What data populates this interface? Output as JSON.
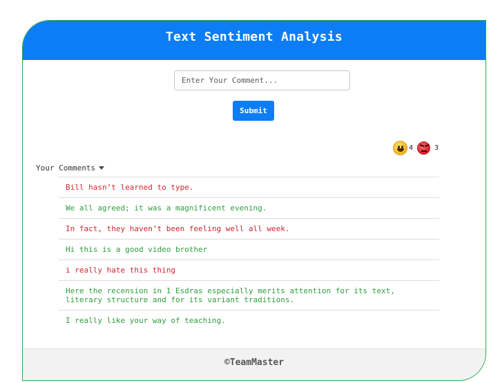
{
  "header": {
    "title": "Text Sentiment Analysis"
  },
  "form": {
    "placeholder": "Enter Your Comment...",
    "submit_label": "Submit"
  },
  "stats": {
    "positive_icon": "grinning-face-icon",
    "positive_count": "4",
    "negative_icon": "angry-face-icon",
    "negative_count": "3"
  },
  "comments": {
    "header_label": "Your Comments",
    "items": [
      {
        "text": "Bill hasn’t learned to type.",
        "sentiment": "negative"
      },
      {
        "text": "We all agreed; it was a magnificent evening.",
        "sentiment": "positive"
      },
      {
        "text": "In fact, they haven’t been feeling well all week.",
        "sentiment": "negative"
      },
      {
        "text": "Hi this is a good video brother",
        "sentiment": "positive"
      },
      {
        "text": "i really hate this thing",
        "sentiment": "negative"
      },
      {
        "text": "Here the recension in 1 Esdras especially merits attention for its text, literary structure and for its variant traditions.",
        "sentiment": "positive"
      },
      {
        "text": "I really like your way of teaching.",
        "sentiment": "positive"
      }
    ]
  },
  "footer": {
    "text": "©TeamMaster"
  },
  "colors": {
    "accent": "#0d7df5",
    "positive": "#2e9d3f",
    "negative": "#d0262f"
  }
}
